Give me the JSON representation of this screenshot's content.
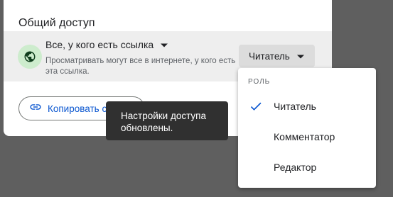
{
  "dialog": {
    "section_title": "Общий доступ",
    "access": {
      "scope_label": "Все, у кого есть ссылка",
      "scope_description": "Просматривать могут все в интернете, у кого есть эта ссылка.",
      "role_label": "Читатель"
    },
    "copy_button_label": "Копировать ссылку"
  },
  "toast": {
    "message": "Настройки доступа обновлены."
  },
  "role_menu": {
    "header": "РОЛЬ",
    "items": [
      {
        "label": "Читатель",
        "selected": true
      },
      {
        "label": "Комментатор",
        "selected": false
      },
      {
        "label": "Редактор",
        "selected": false
      }
    ]
  },
  "colors": {
    "accent": "#0b57d0",
    "globe_background": "#cdeccd",
    "toast_background": "#303030",
    "overlay": "#5f5f5f"
  },
  "icons": {
    "globe": "globe-icon",
    "dropdown": "arrow-drop-down-icon",
    "link": "link-icon",
    "check": "check-icon"
  }
}
